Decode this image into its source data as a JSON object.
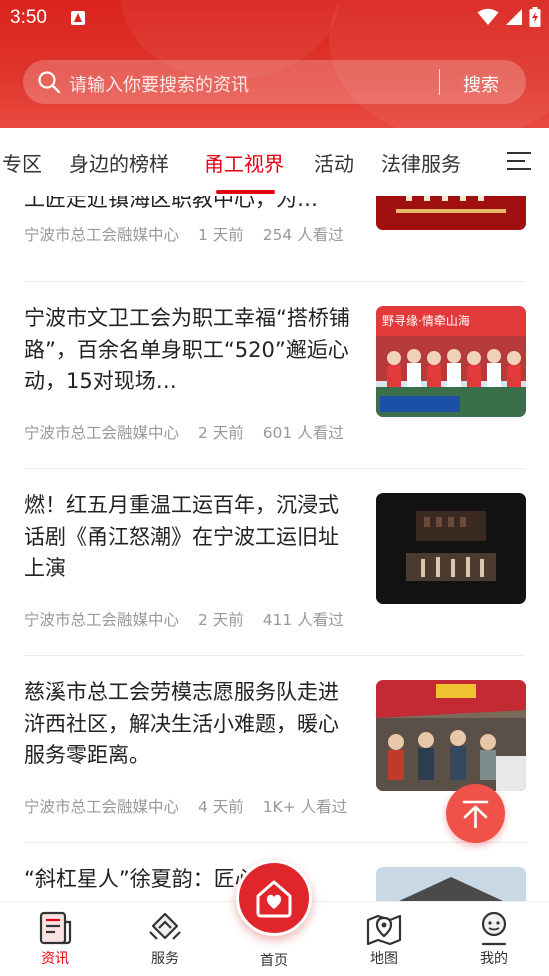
{
  "status_bar": {
    "time": "3:50"
  },
  "search": {
    "placeholder": "请输入你要搜索的资讯",
    "button_label": "搜索"
  },
  "tabs": [
    {
      "label": "专区",
      "active": false
    },
    {
      "label": "身边的榜样",
      "active": false
    },
    {
      "label": "甬工视界",
      "active": true
    },
    {
      "label": "活动",
      "active": false
    },
    {
      "label": "法律服务",
      "active": false
    }
  ],
  "articles": [
    {
      "title": "工匠走近镇海区职教中心，为…",
      "source": "宁波市总工会融媒中心",
      "time": "1 天前",
      "views": "254 人看过",
      "thumb": "red-stage"
    },
    {
      "title": "宁波市文卫工会为职工幸福“搭桥铺路”，百余名单身职工“520”邂逅心动，15对现场…",
      "source": "宁波市总工会融媒中心",
      "time": "2 天前",
      "views": "601 人看过",
      "thumb": "group-photo",
      "thumb_text": "野寻缘·情牵山海"
    },
    {
      "title": "燃！红五月重温工运百年，沉浸式话剧《甬江怒潮》在宁波工运旧址上演",
      "source": "宁波市总工会融媒中心",
      "time": "2 天前",
      "views": "411 人看过",
      "thumb": "dark-stage"
    },
    {
      "title": "慈溪市总工会劳模志愿服务队走进浒西社区，解决生活小难题，暖心服务零距离。",
      "source": "宁波市总工会融媒中心",
      "time": "4 天前",
      "views": "1K+ 人看过",
      "thumb": "tent"
    },
    {
      "title": "“斜杠星人”徐夏韵：匠心技艺",
      "source": "",
      "time": "",
      "views": "",
      "thumb": "building"
    }
  ],
  "bottom_nav": [
    {
      "label": "资讯",
      "icon": "news-icon",
      "active": true
    },
    {
      "label": "服务",
      "icon": "service-icon",
      "active": false
    },
    {
      "label": "首页",
      "icon": "home-icon",
      "active": false
    },
    {
      "label": "地图",
      "icon": "map-icon",
      "active": false
    },
    {
      "label": "我的",
      "icon": "profile-icon",
      "active": false
    }
  ],
  "colors": {
    "brand_red": "#e60012",
    "header_red": "#d9231c",
    "fab_red": "#f0524a"
  }
}
